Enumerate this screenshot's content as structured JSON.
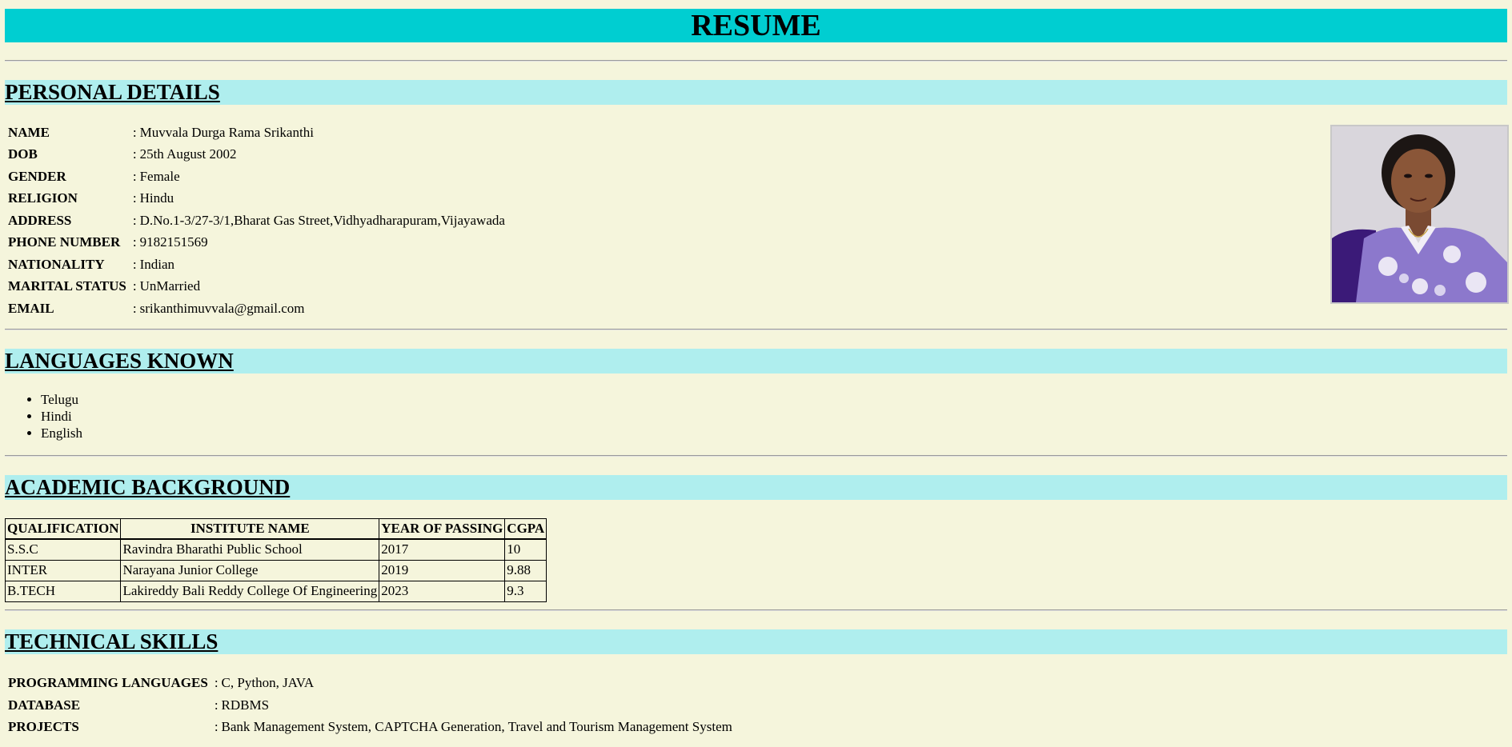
{
  "title": "RESUME",
  "personal": {
    "heading": "PERSONAL DETAILS",
    "rows": [
      {
        "key": "NAME",
        "value": "Muvvala Durga Rama Srikanthi"
      },
      {
        "key": "DOB",
        "value": "25th August 2002"
      },
      {
        "key": "GENDER",
        "value": "Female"
      },
      {
        "key": "RELIGION",
        "value": "Hindu"
      },
      {
        "key": "ADDRESS",
        "value": "D.No.1-3/27-3/1,Bharat Gas Street,Vidhyadharapuram,Vijayawada"
      },
      {
        "key": "PHONE NUMBER",
        "value": "9182151569"
      },
      {
        "key": "NATIONALITY",
        "value": "Indian"
      },
      {
        "key": "MARITAL STATUS",
        "value": "UnMarried"
      },
      {
        "key": "EMAIL",
        "value": "srikanthimuvvala@gmail.com"
      }
    ],
    "separator": ":"
  },
  "languages": {
    "heading": "LANGUAGES KNOWN",
    "items": [
      "Telugu",
      "Hindi",
      "English"
    ]
  },
  "academic": {
    "heading": "ACADEMIC BACKGROUND",
    "columns": [
      "QUALIFICATION",
      "INSTITUTE NAME",
      "YEAR OF PASSING",
      "CGPA"
    ],
    "rows": [
      [
        "S.S.C",
        "Ravindra Bharathi Public School",
        "2017",
        "10"
      ],
      [
        "INTER",
        "Narayana Junior College",
        "2019",
        "9.88"
      ],
      [
        "B.TECH",
        "Lakireddy Bali Reddy College Of Engineering",
        "2023",
        "9.3"
      ]
    ]
  },
  "skills": {
    "heading": "TECHNICAL SKILLS",
    "rows": [
      {
        "key": "PROGRAMMING LANGUAGES",
        "value": "C, Python, JAVA"
      },
      {
        "key": "DATABASE",
        "value": "RDBMS"
      },
      {
        "key": "PROJECTS",
        "value": "Bank Management System, CAPTCHA Generation, Travel and Tourism Management System"
      }
    ]
  },
  "colors": {
    "page_bg": "#f5f5dc",
    "title_bg": "#00ced1",
    "section_bg": "#afeeee"
  }
}
